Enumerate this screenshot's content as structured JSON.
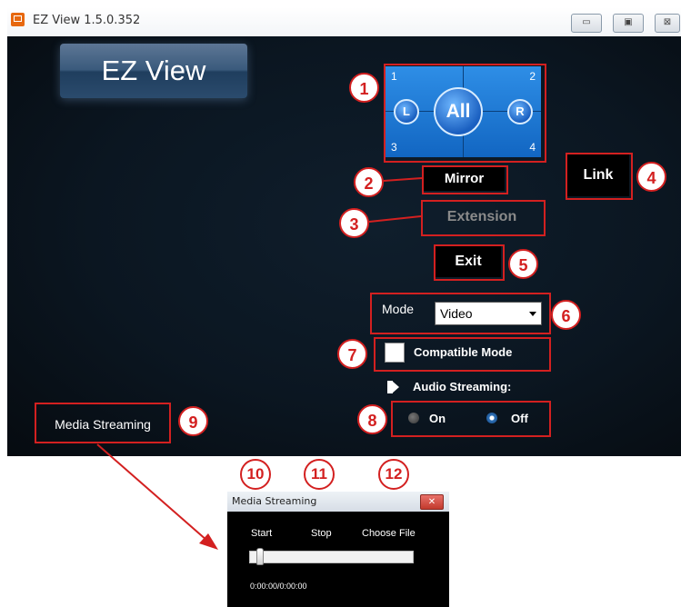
{
  "window": {
    "title": "EZ View 1.5.0.352",
    "buttons": {
      "minimize": "▭",
      "maximize": "▣",
      "close": "⊠"
    }
  },
  "logo": {
    "text": "EZ View"
  },
  "split_panel": {
    "corners": [
      "1",
      "2",
      "3",
      "4"
    ],
    "left_label": "L",
    "center_label": "All",
    "right_label": "R"
  },
  "controls": {
    "mirror_label": "Mirror",
    "extension_label": "Extension",
    "link_label": "Link",
    "exit_label": "Exit",
    "mode_label": "Mode",
    "mode_value": "Video",
    "compatible_mode_label": "Compatible Mode",
    "audio_streaming_label": "Audio Streaming:",
    "audio_on_label": "On",
    "audio_off_label": "Off",
    "media_streaming_label": "Media Streaming"
  },
  "callouts": [
    "1",
    "2",
    "3",
    "4",
    "5",
    "6",
    "7",
    "8",
    "9",
    "10",
    "11",
    "12"
  ],
  "media_window": {
    "title": "Media Streaming",
    "start_label": "Start",
    "stop_label": "Stop",
    "choose_file_label": "Choose File",
    "time": "0:00:00/0:00:00",
    "close_label": "✕",
    "progress": 0
  },
  "colors": {
    "callout_red": "#d32020",
    "panel_blue": "#1b7ad6",
    "background_dark": "#0b1621"
  },
  "icons": {
    "app": "app-icon",
    "speaker": "speaker-icon",
    "dropdown": "chevron-down-icon"
  }
}
